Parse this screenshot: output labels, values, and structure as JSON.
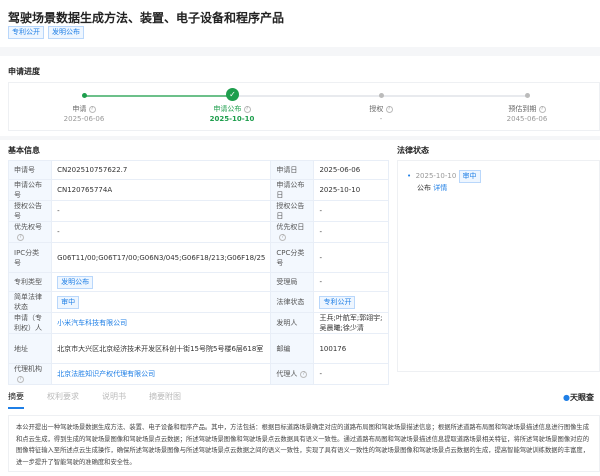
{
  "title": "驾驶场景数据生成方法、装置、电子设备和程序产品",
  "tags": [
    "专利公开",
    "发明公布"
  ],
  "progress": {
    "heading": "申请进度",
    "steps": [
      {
        "label": "申请",
        "date": "2025-06-06"
      },
      {
        "label": "申请公布",
        "date": "2025-10-10"
      },
      {
        "label": "授权",
        "date": "-"
      },
      {
        "label": "预估到期",
        "date": "2045-06-06"
      }
    ],
    "help": "?"
  },
  "basic": {
    "heading": "基本信息",
    "rows": [
      [
        "申请号",
        "CN202510757622.7",
        "申请日",
        "2025-06-06"
      ],
      [
        "申请公布号",
        "CN120765774A",
        "申请公布日",
        "2025-10-10"
      ],
      [
        "授权公告号",
        "-",
        "授权公告日",
        "-"
      ],
      [
        "优先权号",
        "-",
        "优先权日",
        "-"
      ],
      [
        "IPC分类号",
        "G06T11/00;G06T17/00;G06N3/045;G06F18/213;G06F18/25",
        "CPC分类号",
        "-"
      ],
      [
        "专利类型",
        "发明公布",
        "受理局",
        "-"
      ],
      [
        "简单法律状态",
        "审中",
        "法律状态",
        "专利公开"
      ],
      [
        "申请（专利权）人",
        "小米汽车科技有限公司",
        "发明人",
        "王兵;叶航军;郭翊宇;吴晨曦;徐少清"
      ],
      [
        "地址",
        "北京市大兴区北京经济技术开发区科创十街15号院5号楼6层618室",
        "邮编",
        "100176"
      ],
      [
        "代理机构",
        "北京法胜知识产权代理有限公司",
        "代理人",
        "-"
      ]
    ]
  },
  "legal": {
    "heading": "法律状态",
    "date": "2025-10-10",
    "badge": "审中",
    "event": "公布",
    "detail": "详情"
  },
  "tabs": [
    "摘要",
    "权利要求",
    "说明书",
    "摘要附图"
  ],
  "watermark": "天眼查",
  "abstract": "本公开提出一种驾驶场景数据生成方法、装置、电子设备和程序产品。其中，方法包括：根据目标道路场景确定对应的道路布局图和驾驶场景描述信息；根据所述道路布局图和驾驶场景描述信息进行图像生成和点云生成，得到生成的驾驶场景图像和驾驶场景点云数据；所述驾驶场景图像和驾驶场景点云数据具有语义一致性。通过道路布局图和驾驶场景描述信息提取道路场景相关特征，将所述驾驶场景图像对应的图像特征输入至所述点云生成操作，确保所述驾驶场景图像与所述驾驶场景点云数据之间的语义一致性，实现了具有语义一致性的驾驶场景图像和驾驶场景点云数据的生成，提高智能驾驶训练数据的丰富度，进一步提升了智能驾驶的准确度和安全性。"
}
